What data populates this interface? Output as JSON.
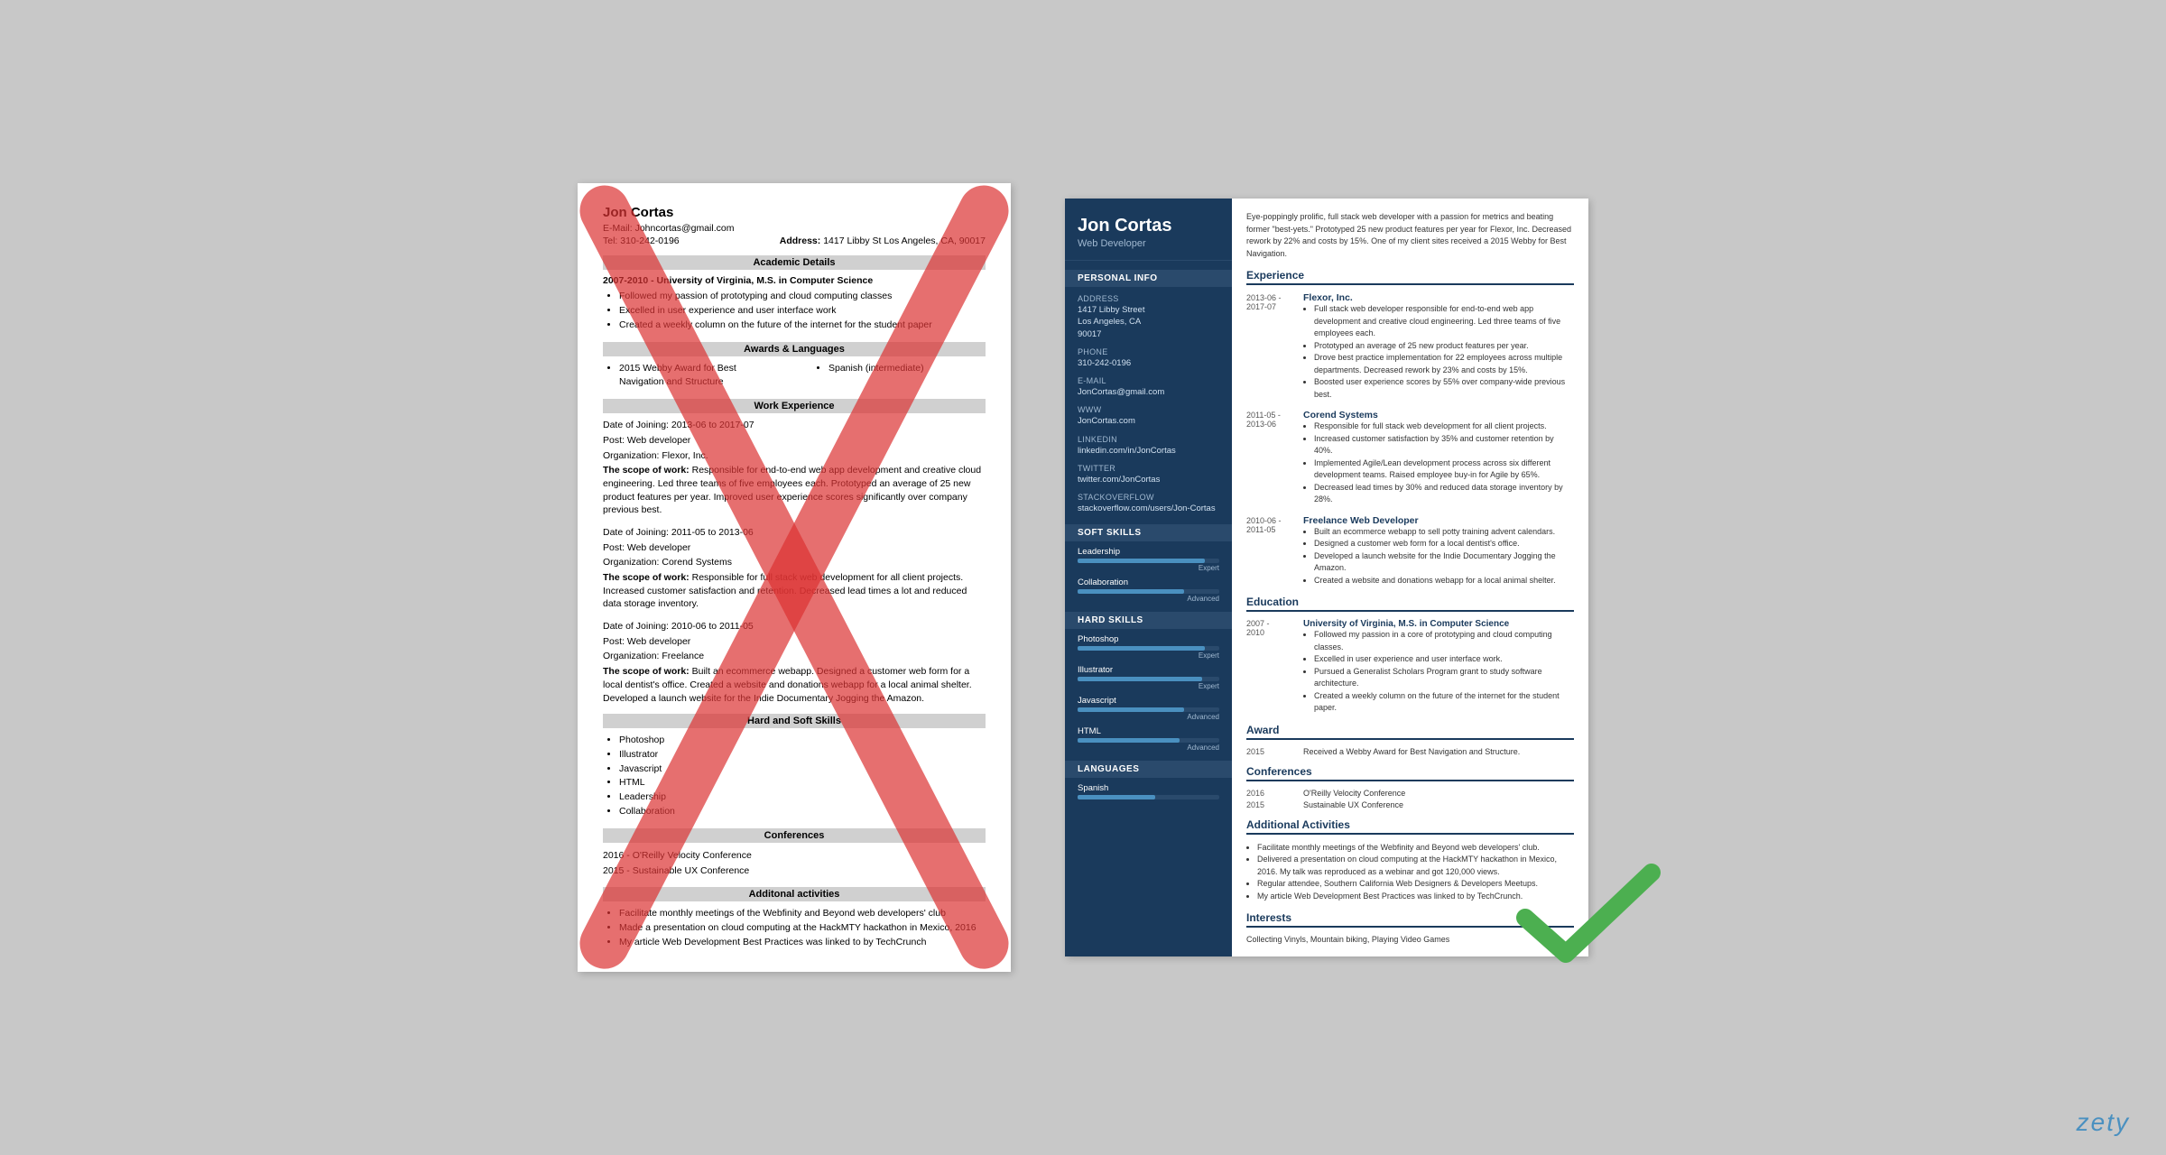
{
  "left_resume": {
    "name": "Jon Cortas",
    "email": "E-Mail: Johncortas@gmail.com",
    "address_label": "Address:",
    "address": "1417 Libby St Los Angeles, CA, 90017",
    "tel": "Tel: 310-242-0196",
    "academic_section": "Academic Details",
    "academic_entry": "2007-2010 - University of Virginia, M.S. in Computer Science",
    "academic_bullets": [
      "Followed my passion of prototyping and cloud computing classes",
      "Excelled in user experience and user interface work",
      "Created a weekly column on the future of the internet for the student paper"
    ],
    "awards_section": "Awards & Languages",
    "award1": "2015 Webby Award for Best Navigation and Structure",
    "award2": "Spanish (intermediate)",
    "work_section": "Work Experience",
    "jobs": [
      {
        "date": "Date of Joining: 2013-06 to 2017-07",
        "post": "Post: Web developer",
        "org": "Organization: Flexor, Inc.",
        "scope_label": "The scope of work:",
        "scope": "Responsible for end-to-end web app development and creative cloud engineering. Led three teams of five employees each. Prototyped an average of 25 new product features per year. Improved user experience scores significantly over company previous best."
      },
      {
        "date": "Date of Joining: 2011-05 to 2013-06",
        "post": "Post: Web developer",
        "org": "Organization: Corend Systems",
        "scope_label": "The scope of work:",
        "scope": "Responsible for full stack web development for all client projects. Increased customer satisfaction and retention. Decreased lead times a lot and reduced data storage inventory."
      },
      {
        "date": "Date of Joining: 2010-06 to 2011-05",
        "post": "Post: Web developer",
        "org": "Organization: Freelance",
        "scope_label": "The scope of work:",
        "scope": "Built an ecommerce webapp. Designed a customer web form for a local dentist's office. Created a website and donations webapp for a local animal shelter. Developed a launch website for the Indie Documentary Jogging the Amazon."
      }
    ],
    "skills_section": "Hard and Soft Skills",
    "skills": [
      "Photoshop",
      "Illustrator",
      "Javascript",
      "HTML",
      "Leadership",
      "Collaboration"
    ],
    "conferences_section": "Conferences",
    "conferences": [
      "2016 - O'Reilly Velocity Conference",
      "2015 - Sustainable UX Conference"
    ],
    "activities_section": "Additonal activities",
    "activities": [
      "Facilitate monthly meetings of the Webfinity and Beyond web developers' club",
      "Made a presentation on cloud computing at the HackMTY hackathon in Mexico, 2016",
      "My article Web Development Best Practices was linked to by TechCrunch"
    ]
  },
  "right_resume": {
    "name": "Jon Cortas",
    "title": "Web Developer",
    "summary": "Eye-poppingly prolific, full stack web developer with a passion for metrics and beating former \"best-yets.\" Prototyped 25 new product features per year for Flexor, Inc. Decreased rework by 22% and costs by 15%. One of my client sites received a 2015 Webby for Best Navigation.",
    "personal_section": "Personal Info",
    "address_label": "Address",
    "address_lines": [
      "1417 Libby Street",
      "Los Angeles, CA",
      "90017"
    ],
    "phone_label": "Phone",
    "phone": "310-242-0196",
    "email_label": "E-mail",
    "email": "JonCortas@gmail.com",
    "www_label": "WWW",
    "www": "JonCortas.com",
    "linkedin_label": "LinkedIn",
    "linkedin": "linkedin.com/in/JonCortas",
    "twitter_label": "Twitter",
    "twitter": "twitter.com/JonCortas",
    "stackoverflow_label": "StackOverflow",
    "stackoverflow": "stackoverflow.com/users/Jon-Cortas",
    "soft_skills_section": "Soft Skills",
    "soft_skills": [
      {
        "name": "Leadership",
        "level": "Expert",
        "pct": 90
      },
      {
        "name": "Collaboration",
        "level": "Advanced",
        "pct": 75
      }
    ],
    "hard_skills_section": "Hard Skills",
    "hard_skills": [
      {
        "name": "Photoshop",
        "level": "Expert",
        "pct": 90
      },
      {
        "name": "Illustrator",
        "level": "Expert",
        "pct": 88
      },
      {
        "name": "Javascript",
        "level": "Advanced",
        "pct": 75
      },
      {
        "name": "HTML",
        "level": "Advanced",
        "pct": 72
      }
    ],
    "languages_section": "Languages",
    "languages": [
      {
        "name": "Spanish",
        "pct": 55
      }
    ],
    "experience_section": "Experience",
    "experience": [
      {
        "dates": "2013-06 -\n2017-07",
        "company": "Flexor, Inc.",
        "bullets": [
          "Full stack web developer responsible for end-to-end web app development and creative cloud engineering. Led three teams of five employees each.",
          "Prototyped an average of 25 new product features per year.",
          "Drove best practice implementation for 22 employees across multiple departments. Decreased rework by 23% and costs by 15%.",
          "Boosted user experience scores by 55% over company-wide previous best."
        ]
      },
      {
        "dates": "2011-05 -\n2013-06",
        "company": "Corend Systems",
        "bullets": [
          "Responsible for full stack web development for all client projects.",
          "Increased customer satisfaction by 35% and customer retention by 40%.",
          "Implemented Agile/Lean development process across six different development teams. Raised employee buy-in for Agile by 65%.",
          "Decreased lead times by 30% and reduced data storage inventory by 28%."
        ]
      },
      {
        "dates": "2010-06 -\n2011-05",
        "company": "Freelance Web Developer",
        "bullets": [
          "Built an ecommerce webapp to sell potty training advent calendars.",
          "Designed a customer web form for a local dentist's office.",
          "Developed a launch website for the Indie Documentary Jogging the Amazon.",
          "Created a website and donations webapp for a local animal shelter."
        ]
      }
    ],
    "education_section": "Education",
    "education": [
      {
        "dates": "2007 -\n2010",
        "title": "University of Virginia, M.S. in Computer Science",
        "bullets": [
          "Followed my passion in a core of prototyping and cloud computing classes.",
          "Excelled in user experience and user interface work.",
          "Pursued a Generalist Scholars Program grant to study software architecture.",
          "Created a weekly column on the future of the internet for the student paper."
        ]
      }
    ],
    "award_section": "Award",
    "award_year": "2015",
    "award_text": "Received a Webby Award for Best Navigation and Structure.",
    "conferences_section": "Conferences",
    "conferences": [
      {
        "year": "2016",
        "name": "O'Reilly Velocity Conference"
      },
      {
        "year": "2015",
        "name": "Sustainable UX Conference"
      }
    ],
    "activities_section": "Additional Activities",
    "activities": [
      "Facilitate monthly meetings of the Webfinity and Beyond web developers' club.",
      "Delivered a presentation on cloud computing at the HackMTY hackathon in Mexico, 2016. My talk was reproduced as a webinar and got 120,000 views.",
      "Regular attendee, Southern California Web Designers & Developers Meetups.",
      "My article Web Development Best Practices was linked to by TechCrunch."
    ],
    "interests_section": "Interests",
    "interests": "Collecting Vinyls, Mountain biking, Playing Video Games"
  },
  "watermark": "zety"
}
